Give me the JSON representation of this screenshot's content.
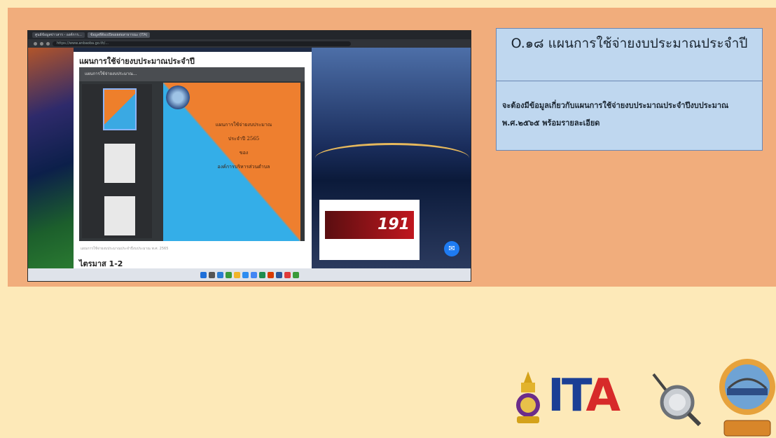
{
  "browser": {
    "tabs": [
      "ศูนย์ข้อมูลข่าวสาร - องค์การ...",
      "ข้อมูลที่ต้องเปิดเผยต่อสาธารณะ (ITA)"
    ],
    "address": "https://www.anbaoba.go.th/..."
  },
  "page": {
    "title": "แผนการใช้จ่ายงบประมาณประจำปี",
    "viewer_toolbar": "แผนการใช้จ่ายงบประมาณ...",
    "pdf_lines": [
      "แผนการใช้จ่ายงบประมาณ",
      "ประจำปี 2565",
      "ของ",
      "องค์การบริหารส่วนตำบล"
    ],
    "caption": "แผนการใช้จ่ายงบประมาณประจำปีงบประมาณ พ.ศ. 2565",
    "next_heading": "ไตรมาส 1-2",
    "ad_text": "191"
  },
  "panel": {
    "title": "O.๑๘ แผนการใช้จ่ายงบประมาณประจำปี",
    "description": "จะต้องมีข้อมูลเกี่ยวกับแผนการใช้จ่ายงบประมาณประจำปีงบประมาณ พ.ศ.๒๕๖๕ พร้อมรายละเอียด"
  },
  "footer": {
    "ita_logo": "ITA"
  },
  "colors": {
    "band": "#f1ad7c",
    "background": "#fde9b8",
    "box": "#bfd7ef",
    "ita_blue": "#1b3f95",
    "ita_red": "#d72a2a"
  }
}
